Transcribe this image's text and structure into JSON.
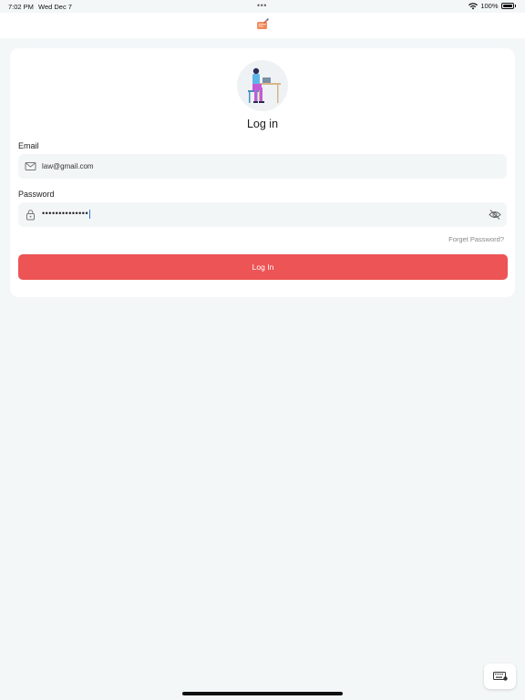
{
  "status_bar": {
    "time": "7:02 PM",
    "date": "Wed Dec 7",
    "dots": "•••",
    "battery": "100%"
  },
  "login": {
    "title": "Log in",
    "email_label": "Email",
    "email_value": "law@gmail.com",
    "password_label": "Password",
    "password_value": "••••••••••••••",
    "forget_password": "Forget Password?",
    "submit_label": "Log In"
  },
  "colors": {
    "accent": "#ec5455",
    "background": "#f4f7f8",
    "field_background": "#f3f6f7"
  },
  "icons": [
    "wifi-icon",
    "battery-icon",
    "app-logo",
    "mail-icon",
    "lock-icon",
    "eye-off-icon",
    "keyboard-icon"
  ]
}
